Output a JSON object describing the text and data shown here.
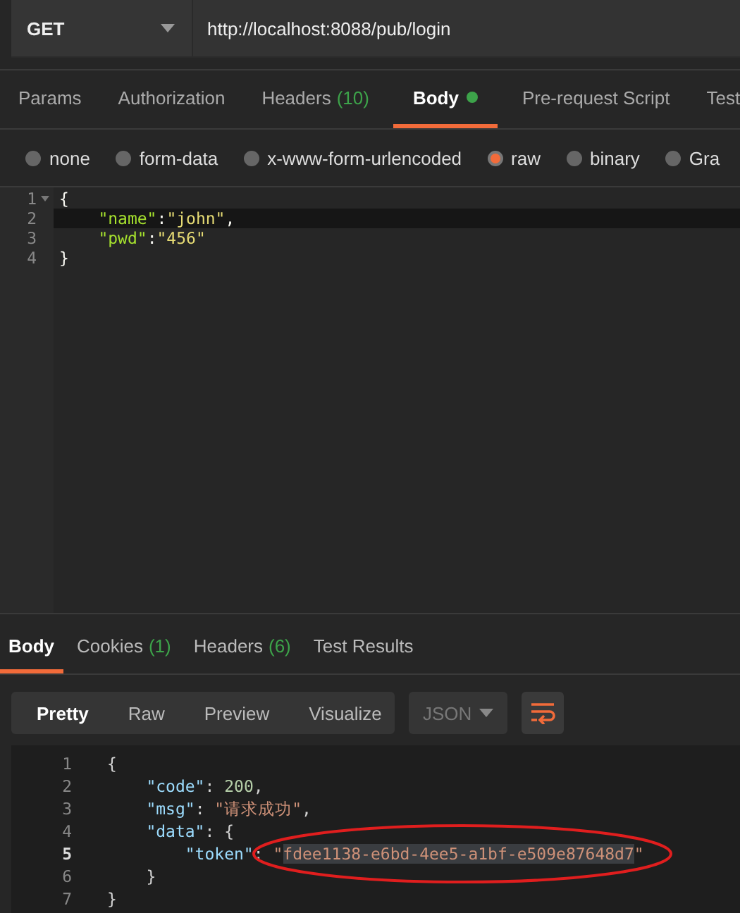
{
  "request": {
    "method": "GET",
    "url": "http://localhost:8088/pub/login"
  },
  "request_tabs": [
    {
      "label": "Params",
      "selected": false
    },
    {
      "label": "Authorization",
      "selected": false
    },
    {
      "label": "Headers",
      "count": "(10)",
      "selected": false
    },
    {
      "label": "Body",
      "selected": true,
      "dot": true
    },
    {
      "label": "Pre-request Script",
      "selected": false
    },
    {
      "label": "Test",
      "selected": false
    }
  ],
  "body_types": [
    {
      "label": "none",
      "selected": false
    },
    {
      "label": "form-data",
      "selected": false
    },
    {
      "label": "x-www-form-urlencoded",
      "selected": false
    },
    {
      "label": "raw",
      "selected": true
    },
    {
      "label": "binary",
      "selected": false
    },
    {
      "label": "Gra",
      "selected": false
    }
  ],
  "request_editor": {
    "lines": [
      {
        "number": "1",
        "foldable": true,
        "current": false,
        "tokens": [
          {
            "kind": "punct",
            "text": "{"
          }
        ]
      },
      {
        "number": "2",
        "foldable": false,
        "current": true,
        "tokens": [
          {
            "kind": "key",
            "text": "    \"name\""
          },
          {
            "kind": "punct",
            "text": ":"
          },
          {
            "kind": "string",
            "text": "\"john\""
          },
          {
            "kind": "punct",
            "text": ","
          }
        ]
      },
      {
        "number": "3",
        "foldable": false,
        "current": false,
        "tokens": [
          {
            "kind": "key",
            "text": "    \"pwd\""
          },
          {
            "kind": "punct",
            "text": ":"
          },
          {
            "kind": "string",
            "text": "\"456\""
          }
        ]
      },
      {
        "number": "4",
        "foldable": false,
        "current": false,
        "tokens": [
          {
            "kind": "punct",
            "text": "}"
          }
        ]
      }
    ]
  },
  "response_tabs": [
    {
      "label": "Body",
      "selected": true
    },
    {
      "label": "Cookies",
      "count": "(1)",
      "selected": false
    },
    {
      "label": "Headers",
      "count": "(6)",
      "selected": false
    },
    {
      "label": "Test Results",
      "selected": false
    }
  ],
  "view_modes": [
    {
      "label": "Pretty",
      "selected": true
    },
    {
      "label": "Raw",
      "selected": false
    },
    {
      "label": "Preview",
      "selected": false
    },
    {
      "label": "Visualize",
      "selected": false
    }
  ],
  "format_select": {
    "value": "JSON"
  },
  "response_viewer": {
    "lines": [
      {
        "number": "1",
        "current": false,
        "tokens": [
          {
            "kind": "punct",
            "text": "{"
          }
        ]
      },
      {
        "number": "2",
        "current": false,
        "tokens": [
          {
            "kind": "key",
            "text": "    \"code\""
          },
          {
            "kind": "punct",
            "text": ": "
          },
          {
            "kind": "number",
            "text": "200"
          },
          {
            "kind": "punct",
            "text": ","
          }
        ]
      },
      {
        "number": "3",
        "current": false,
        "tokens": [
          {
            "kind": "key",
            "text": "    \"msg\""
          },
          {
            "kind": "punct",
            "text": ": "
          },
          {
            "kind": "rstring",
            "text": "\"请求成功\""
          },
          {
            "kind": "punct",
            "text": ","
          }
        ]
      },
      {
        "number": "4",
        "current": false,
        "tokens": [
          {
            "kind": "key",
            "text": "    \"data\""
          },
          {
            "kind": "punct",
            "text": ": {"
          }
        ]
      },
      {
        "number": "5",
        "current": true,
        "tokens": [
          {
            "kind": "key",
            "text": "        \"token\""
          },
          {
            "kind": "punct",
            "text": ": "
          },
          {
            "kind": "rstring",
            "text": "\""
          },
          {
            "kind": "rstring",
            "text": "fdee1138-e6bd-4ee5-a1bf-e509e87648d7",
            "selected": true
          },
          {
            "kind": "rstring",
            "text": "\""
          }
        ]
      },
      {
        "number": "6",
        "current": false,
        "tokens": [
          {
            "kind": "punct",
            "text": "    }"
          }
        ]
      },
      {
        "number": "7",
        "current": false,
        "tokens": [
          {
            "kind": "punct",
            "text": "}"
          }
        ]
      }
    ]
  }
}
